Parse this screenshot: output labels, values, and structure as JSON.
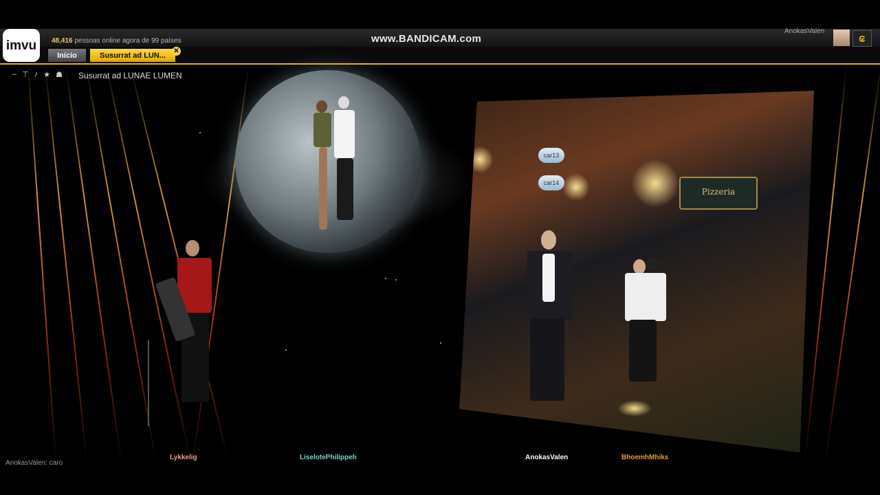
{
  "app": {
    "logo_text": "imvu",
    "online_count": "48,416",
    "online_text": "pessoas online agora de 99 países",
    "watermark": "www.BANDICAM.com",
    "username": "AnokasValen",
    "credits_symbol": "₢"
  },
  "tabs": [
    {
      "label": "Início"
    },
    {
      "label": "Susurrat ad LUN..."
    }
  ],
  "room": {
    "tools": [
      "–",
      "⊤",
      "♪",
      "★",
      "☗"
    ],
    "title": "Susurrat ad LUNAE LUMEN"
  },
  "scene": {
    "bubbles": [
      "car13",
      "car14"
    ],
    "poster_sign": "Pizzeria"
  },
  "avatars": [
    {
      "name": "Lykkelig",
      "color": "#e7a08a"
    },
    {
      "name": "LiselotePhilippeh",
      "color": "#7fd0c6"
    },
    {
      "name": "AnokasValen",
      "color": "#ffffff"
    },
    {
      "name": "BhoemhMhiks",
      "color": "#e8a030"
    }
  ],
  "chat": {
    "last_line": "AnokasValen: caro"
  },
  "colors": {
    "accent": "#e7b400"
  }
}
